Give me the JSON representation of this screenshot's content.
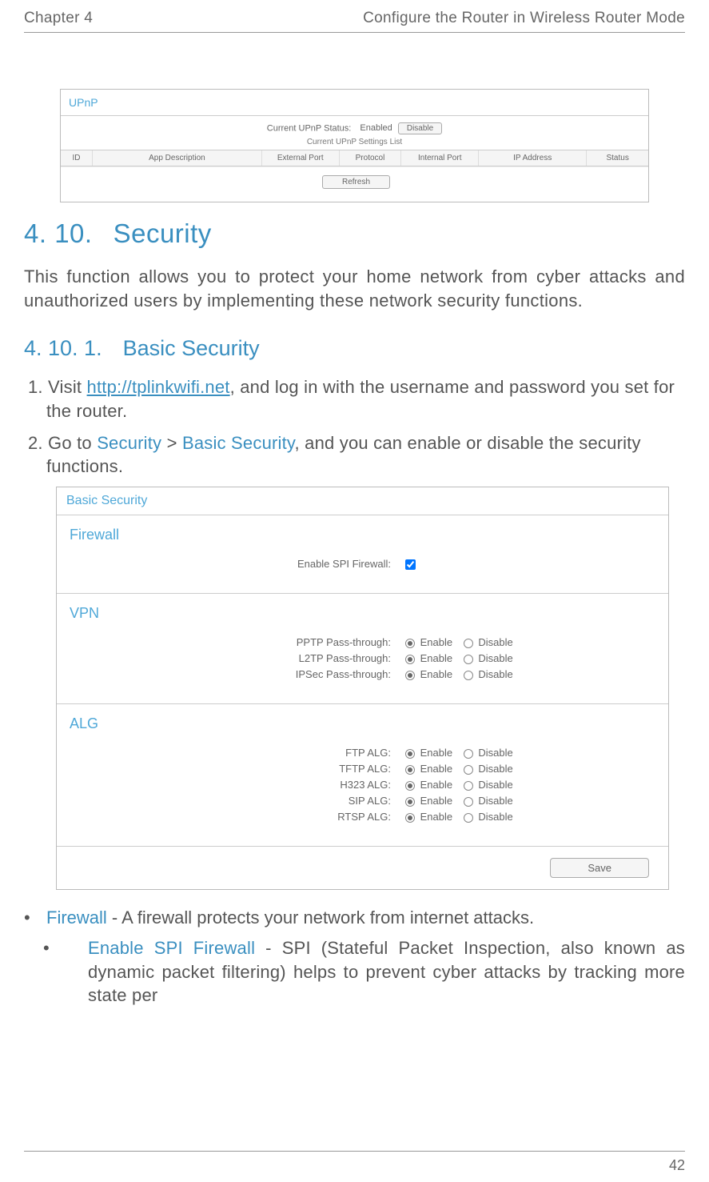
{
  "header": {
    "left": "Chapter 4",
    "right": "Configure the Router in Wireless Router Mode"
  },
  "upnp": {
    "title": "UPnP",
    "status_label": "Current UPnP Status:",
    "status_value": "Enabled",
    "disable_btn": "Disable",
    "list_title": "Current UPnP Settings List",
    "cols": {
      "id": "ID",
      "desc": "App Description",
      "eport": "External Port",
      "proto": "Protocol",
      "iport": "Internal Port",
      "ip": "IP Address",
      "stat": "Status"
    },
    "refresh": "Refresh"
  },
  "sec_heading": {
    "num": "4. 10.",
    "title": "Security"
  },
  "sec_para": "This function allows you to protect your home network from cyber attacks and unauthorized users by implementing these network security functions.",
  "sub_heading": {
    "num": "4. 10. 1.",
    "title": "Basic Security"
  },
  "step1": {
    "pre": "1. Visit ",
    "link": "http://tplinkwifi.net",
    "post": ", and log in with the username and password you set for the router."
  },
  "step2": {
    "pre": "2. Go to ",
    "nav1": "Security",
    "sep": " > ",
    "nav2": "Basic Security",
    "post": ", and you can enable or disable the security functions."
  },
  "basic_security": {
    "title": "Basic Security",
    "firewall": {
      "head": "Firewall",
      "label": "Enable SPI Firewall:"
    },
    "vpn": {
      "head": "VPN",
      "rows": [
        {
          "label": "PPTP Pass-through:"
        },
        {
          "label": "L2TP Pass-through:"
        },
        {
          "label": "IPSec Pass-through:"
        }
      ]
    },
    "alg": {
      "head": "ALG",
      "rows": [
        {
          "label": "FTP ALG:"
        },
        {
          "label": "TFTP ALG:"
        },
        {
          "label": "H323 ALG:"
        },
        {
          "label": "SIP ALG:"
        },
        {
          "label": "RTSP ALG:"
        }
      ]
    },
    "opt_enable": "Enable",
    "opt_disable": "Disable",
    "save": "Save"
  },
  "bullets": {
    "firewall_term": "Firewall",
    "firewall_desc": " - A firewall protects your network from internet attacks.",
    "spi_term": "Enable SPI Firewall",
    "spi_desc": " - SPI (Stateful Packet Inspection, also known as dynamic packet filtering) helps to prevent cyber attacks by tracking more state per"
  },
  "page_number": "42"
}
